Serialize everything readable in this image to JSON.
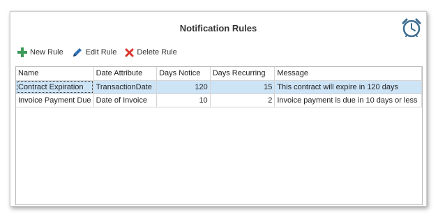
{
  "window": {
    "title": "Notification Rules"
  },
  "toolbar": {
    "new_label": "New Rule",
    "edit_label": "Edit Rule",
    "delete_label": "Delete Rule"
  },
  "table": {
    "columns": [
      "Name",
      "Date Attribute",
      "Days Notice",
      "Days Recurring",
      "Message"
    ],
    "rows": [
      [
        "Contract Expiration",
        "TransactionDate",
        "120",
        "15",
        "This contract will expire in 120 days"
      ],
      [
        "Invoice Payment Due",
        "Date of Invoice",
        "10",
        "2",
        "Invoice payment is due in 10 days or less"
      ]
    ]
  },
  "colors": {
    "selected_row": "#cde4f7",
    "plus": "#3f9b5a",
    "delete": "#d9342b",
    "clock": "#3d6e91"
  }
}
